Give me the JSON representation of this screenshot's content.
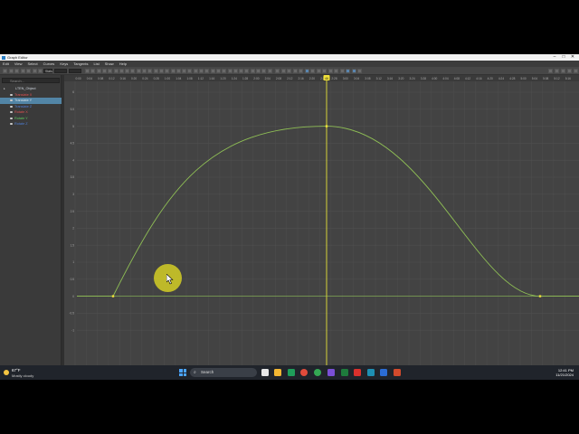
{
  "window": {
    "title": "Graph Editor"
  },
  "menu": [
    "Edit",
    "View",
    "Select",
    "Curves",
    "Keys",
    "Tangents",
    "List",
    "Show",
    "Help"
  ],
  "toolbar": {
    "stats_label": "Stats"
  },
  "outliner": {
    "search_placeholder": "Search...",
    "items": [
      {
        "label": "LTEN_Object",
        "color": "#cfd6df",
        "level": "object"
      },
      {
        "label": "Translate X",
        "color": "#e05050",
        "level": "channel"
      },
      {
        "label": "Translate Y",
        "color": "#d9e4ea",
        "level": "channel",
        "selected": true
      },
      {
        "label": "Translate Z",
        "color": "#4f7fd8",
        "level": "channel"
      },
      {
        "label": "Rotate X",
        "color": "#e05050",
        "level": "channel"
      },
      {
        "label": "Rotate Y",
        "color": "#5ec85e",
        "level": "channel"
      },
      {
        "label": "Rotate Z",
        "color": "#4f7fd8",
        "level": "channel"
      }
    ]
  },
  "timeline": {
    "ticks": [
      "0:00",
      "0:04",
      "0:08",
      "0:12",
      "0:16",
      "0:20",
      "0:24",
      "0:28",
      "1:00",
      "1:04",
      "1:08",
      "1:12",
      "1:16",
      "1:20",
      "1:24",
      "1:28",
      "2:00",
      "2:04",
      "2:08",
      "2:12",
      "2:16",
      "2:20",
      "2:24",
      "2:28",
      "3:00",
      "3:04",
      "3:08",
      "3:12",
      "3:16",
      "3:20",
      "3:24",
      "3:28",
      "4:00",
      "4:04",
      "4:08",
      "4:12",
      "4:16",
      "4:20",
      "4:24",
      "4:28",
      "5:00",
      "5:04",
      "5:08",
      "5:12",
      "5:16"
    ],
    "current_frame": "46"
  },
  "y_axis_labels": [
    "6",
    "5.5",
    "5",
    "4.5",
    "4",
    "3.5",
    "3",
    "2.5",
    "2",
    "1.5",
    "1",
    "0.5",
    "0",
    "-0.5",
    "-1"
  ],
  "curve": {
    "color": "#8fbf55",
    "key_color": "#f0e03a"
  },
  "taskbar": {
    "weather_temp": "67°F",
    "weather_desc": "Mostly cloudy",
    "search_label": "Search",
    "time": "12:41 PM",
    "date": "11/21/2024"
  }
}
